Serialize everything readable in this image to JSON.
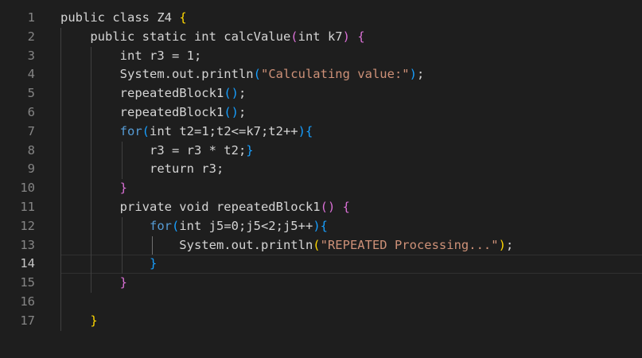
{
  "editor": {
    "active_line": 14,
    "line_numbers": [
      "1",
      "2",
      "3",
      "4",
      "5",
      "6",
      "7",
      "8",
      "9",
      "10",
      "11",
      "12",
      "13",
      "14",
      "15",
      "16",
      "17"
    ],
    "lines": [
      [
        {
          "t": "public class Z4 ",
          "c": "pl"
        },
        {
          "t": "{",
          "c": "b1"
        }
      ],
      [
        {
          "t": "    public static int calcValue",
          "c": "pl"
        },
        {
          "t": "(",
          "c": "b2"
        },
        {
          "t": "int k7",
          "c": "pl"
        },
        {
          "t": ")",
          "c": "b2"
        },
        {
          "t": " ",
          "c": "pl"
        },
        {
          "t": "{",
          "c": "b2"
        }
      ],
      [
        {
          "t": "        int r3 = 1;",
          "c": "pl"
        }
      ],
      [
        {
          "t": "        System.out.println",
          "c": "pl"
        },
        {
          "t": "(",
          "c": "b3"
        },
        {
          "t": "\"Calculating value:\"",
          "c": "st"
        },
        {
          "t": ")",
          "c": "b3"
        },
        {
          "t": ";",
          "c": "pl"
        }
      ],
      [
        {
          "t": "        repeatedBlock1",
          "c": "pl"
        },
        {
          "t": "()",
          "c": "b3"
        },
        {
          "t": ";",
          "c": "pl"
        }
      ],
      [
        {
          "t": "        repeatedBlock1",
          "c": "pl"
        },
        {
          "t": "()",
          "c": "b3"
        },
        {
          "t": ";",
          "c": "pl"
        }
      ],
      [
        {
          "t": "        ",
          "c": "pl"
        },
        {
          "t": "for",
          "c": "kw"
        },
        {
          "t": "(",
          "c": "b3"
        },
        {
          "t": "int t2=1;t2<=k7;t2++",
          "c": "pl"
        },
        {
          "t": ")",
          "c": "b3"
        },
        {
          "t": "{",
          "c": "b3"
        }
      ],
      [
        {
          "t": "            r3 = r3 * t2;",
          "c": "pl"
        },
        {
          "t": "}",
          "c": "b3"
        }
      ],
      [
        {
          "t": "            return r3;",
          "c": "pl"
        }
      ],
      [
        {
          "t": "        ",
          "c": "pl"
        },
        {
          "t": "}",
          "c": "b2"
        }
      ],
      [
        {
          "t": "        private void repeatedBlock1",
          "c": "pl"
        },
        {
          "t": "()",
          "c": "b2"
        },
        {
          "t": " ",
          "c": "pl"
        },
        {
          "t": "{",
          "c": "b2"
        }
      ],
      [
        {
          "t": "            ",
          "c": "pl"
        },
        {
          "t": "for",
          "c": "kw"
        },
        {
          "t": "(",
          "c": "b3"
        },
        {
          "t": "int j5=0;j5<2;j5++",
          "c": "pl"
        },
        {
          "t": ")",
          "c": "b3"
        },
        {
          "t": "{",
          "c": "b3"
        }
      ],
      [
        {
          "t": "                System.out.println",
          "c": "pl"
        },
        {
          "t": "(",
          "c": "b1"
        },
        {
          "t": "\"REPEATED Processing...\"",
          "c": "st"
        },
        {
          "t": ")",
          "c": "b1"
        },
        {
          "t": ";",
          "c": "pl"
        }
      ],
      [
        {
          "t": "            ",
          "c": "pl"
        },
        {
          "t": "}",
          "c": "b3"
        }
      ],
      [
        {
          "t": "        ",
          "c": "pl"
        },
        {
          "t": "}",
          "c": "b2"
        }
      ],
      [],
      [
        {
          "t": "    ",
          "c": "pl"
        },
        {
          "t": "}",
          "c": "b1"
        }
      ]
    ],
    "colors": {
      "background": "#1e1e1e",
      "line_number": "#858585",
      "active_line_number": "#c6c6c6",
      "text": "#d4d4d4",
      "keyword": "#569cd6",
      "string": "#ce9178",
      "bracket_level_1": "#ffd700",
      "bracket_level_2": "#da70d6",
      "bracket_level_3": "#179fff"
    }
  }
}
